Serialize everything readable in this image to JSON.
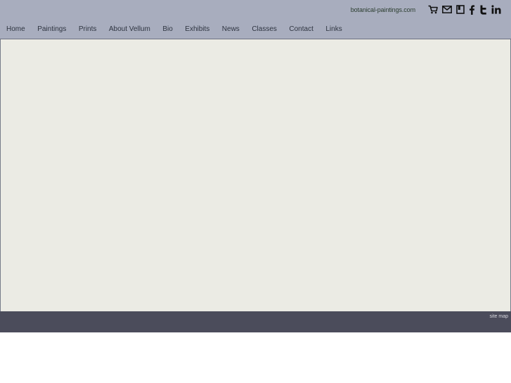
{
  "header": {
    "domain": "botanical-paintings.com",
    "social_icons": [
      "cart-icon",
      "mail-icon",
      "bookmark-icon",
      "facebook-icon",
      "twitter-icon",
      "linkedin-icon"
    ]
  },
  "nav": {
    "items": [
      "Home",
      "Paintings",
      "Prints",
      "About Vellum",
      "Bio",
      "Exhibits",
      "News",
      "Classes",
      "Contact",
      "Links"
    ]
  },
  "footer": {
    "site_map": "site map"
  },
  "colors": {
    "header_bg": "#a8adbe",
    "content_bg": "#ebebe4",
    "footer_bg": "#4b4c5b"
  }
}
